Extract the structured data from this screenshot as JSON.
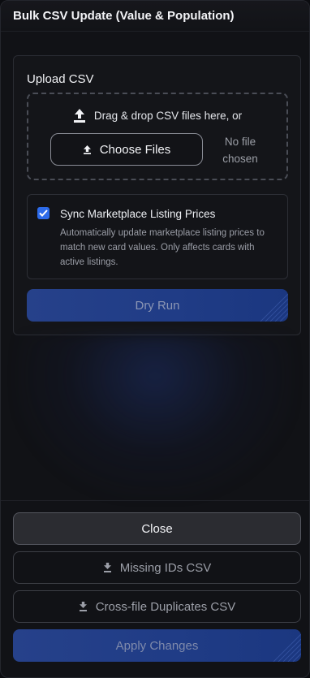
{
  "header": {
    "title": "Bulk CSV Update (Value & Population)"
  },
  "upload": {
    "label": "Upload CSV",
    "dropzone_text": "Drag & drop CSV files here, or",
    "choose_files_label": "Choose Files",
    "no_file_line1": "No file",
    "no_file_line2": "chosen",
    "icons": [
      "upload-icon",
      "small-upload-icon"
    ]
  },
  "sync": {
    "checked": true,
    "title": "Sync Marketplace Listing Prices",
    "description": "Automatically update marketplace listing prices to match new card values. Only affects cards with active listings."
  },
  "actions": {
    "dry_run": "Dry Run",
    "close": "Close",
    "missing_ids": "Missing IDs CSV",
    "duplicates": "Cross-file Duplicates CSV",
    "apply": "Apply Changes"
  },
  "colors": {
    "background": "#111216",
    "accent": "#2d6bea",
    "primary_button": "#203c86",
    "muted_text": "#9a9da6"
  }
}
